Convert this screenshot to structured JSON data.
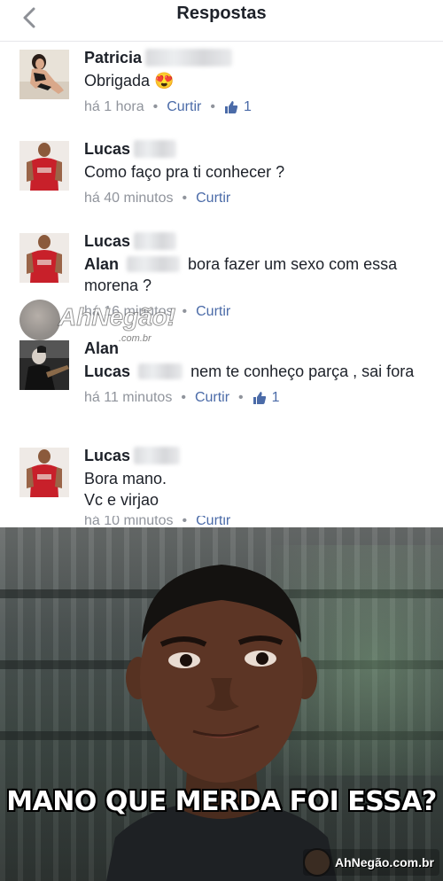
{
  "header": {
    "title": "Respostas"
  },
  "comments": [
    {
      "name": "Patricia",
      "text": "Obrigada",
      "emoji": "😍",
      "time": "há 1 hora",
      "like_label": "Curtir",
      "likes": "1"
    },
    {
      "name": "Lucas",
      "text": "Como faço pra ti conhecer ?",
      "time": "há 40 minutos",
      "like_label": "Curtir"
    },
    {
      "name": "Lucas",
      "mention": "Alan",
      "text": "bora fazer um sexo com essa morena ?",
      "time": "há 16 minutos",
      "like_label": "Curtir"
    },
    {
      "name": "Alan",
      "mention": "Lucas",
      "text": "nem te conheço parça , sai fora",
      "time": "há 11 minutos",
      "like_label": "Curtir",
      "likes": "1"
    },
    {
      "name": "Lucas",
      "text": "Bora mano.\n Vc e virjao",
      "time": "há 10 minutos",
      "like_label": "Curtir"
    }
  ],
  "watermark": {
    "brand": "AhNegão!",
    "domain": ".com.br"
  },
  "meme": {
    "caption": "MANO QUE MERDA FOI ESSA?",
    "logo_text": "AhNegão.com.br"
  },
  "colors": {
    "link": "#4b6ba8",
    "meta": "#90949c",
    "text": "#1d2129"
  }
}
